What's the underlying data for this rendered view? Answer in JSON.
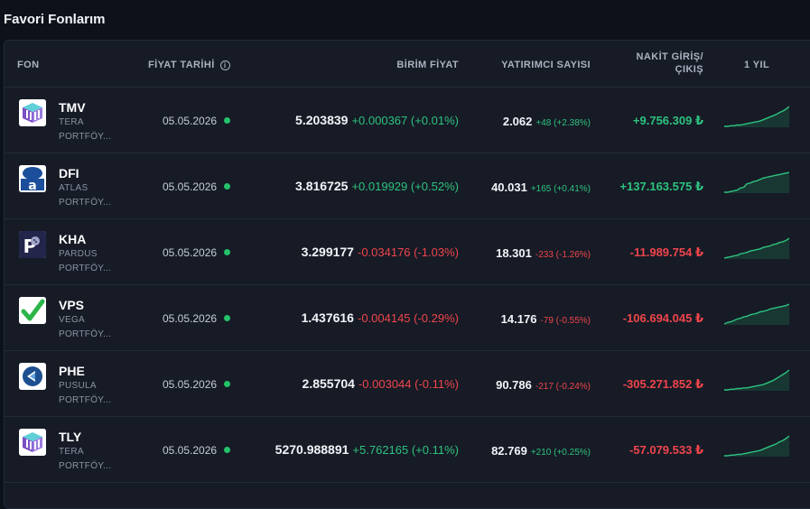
{
  "page_title": "Favori Fonlarım",
  "colors": {
    "positive": "#2ec27e",
    "negative": "#f0454b",
    "live_dot": "#24c26a"
  },
  "table": {
    "headers": {
      "fon": "FON",
      "fiyat_tarihi": "FİYAT TARİHİ",
      "birim_fiyat": "BİRİM FİYAT",
      "yatirimci_sayisi": "YATIRIMCI SAYISI",
      "nakit_giris_1": "NAKİT GİRİŞ/",
      "nakit_giris_2": "ÇIKIŞ",
      "bir_yil": "1 YIL"
    },
    "info_icon": "info-icon",
    "rows": [
      {
        "code": "TMV",
        "company": "TERA",
        "company2": "PORTFÖY...",
        "logo": "tera-logo",
        "date": "05.05.2026",
        "price": "5.203839",
        "change": "+0.000367 (+0.01%)",
        "price_trend": "up",
        "investors": "2.062",
        "investors_change": "+48 (+2.38%)",
        "investors_trend": "up",
        "cash_flow": "+9.756.309 ₺",
        "cash_trend": "up",
        "spark": [
          10,
          10,
          11,
          11,
          12,
          12,
          13,
          14,
          15,
          16,
          17,
          18,
          20,
          22,
          24,
          26,
          28,
          31,
          33,
          36,
          40
        ]
      },
      {
        "code": "DFI",
        "company": "ATLAS",
        "company2": "PORTFÖY...",
        "logo": "atlas-logo",
        "date": "05.05.2026",
        "price": "3.816725",
        "change": "+0.019929 (+0.52%)",
        "price_trend": "up",
        "investors": "40.031",
        "investors_change": "+165 (+0.41%)",
        "investors_trend": "up",
        "cash_flow": "+137.163.575 ₺",
        "cash_trend": "up",
        "spark": [
          10,
          10,
          11,
          12,
          13,
          16,
          17,
          22,
          23,
          25,
          26,
          28,
          30,
          31,
          32,
          33,
          34,
          35,
          36,
          37,
          38
        ]
      },
      {
        "code": "KHA",
        "company": "PARDUS",
        "company2": "PORTFÖY...",
        "logo": "pardus-logo",
        "date": "05.05.2026",
        "price": "3.299177",
        "change": "-0.034176 (-1.03%)",
        "price_trend": "down",
        "investors": "18.301",
        "investors_change": "-233 (-1.26%)",
        "investors_trend": "down",
        "cash_flow": "-11.989.754 ₺",
        "cash_trend": "down",
        "spark": [
          10,
          11,
          12,
          13,
          14,
          16,
          17,
          18,
          20,
          21,
          22,
          23,
          25,
          26,
          27,
          29,
          30,
          32,
          33,
          35,
          38
        ]
      },
      {
        "code": "VPS",
        "company": "VEGA",
        "company2": "PORTFÖY...",
        "logo": "vega-logo",
        "date": "05.05.2026",
        "price": "1.437616",
        "change": "-0.004145 (-0.29%)",
        "price_trend": "down",
        "investors": "14.176",
        "investors_change": "-79 (-0.55%)",
        "investors_trend": "down",
        "cash_flow": "-106.694.045 ₺",
        "cash_trend": "down",
        "spark": [
          10,
          12,
          13,
          15,
          17,
          18,
          20,
          21,
          23,
          24,
          25,
          27,
          28,
          29,
          31,
          32,
          33,
          34,
          35,
          36,
          38
        ]
      },
      {
        "code": "PHE",
        "company": "PUSULA",
        "company2": "PORTFÖY...",
        "logo": "pusula-logo",
        "date": "05.05.2026",
        "price": "2.855704",
        "change": "-0.003044 (-0.11%)",
        "price_trend": "down",
        "investors": "90.786",
        "investors_change": "-217 (-0.24%)",
        "investors_trend": "down",
        "cash_flow": "-305.271.852 ₺",
        "cash_trend": "down",
        "spark": [
          10,
          10,
          11,
          11,
          12,
          12,
          13,
          13,
          14,
          15,
          16,
          17,
          18,
          20,
          22,
          24,
          27,
          30,
          33,
          36,
          40
        ]
      },
      {
        "code": "TLY",
        "company": "TERA",
        "company2": "PORTFÖY...",
        "logo": "tera-logo",
        "date": "05.05.2026",
        "price": "5270.988891",
        "change": "+5.762165 (+0.11%)",
        "price_trend": "up",
        "investors": "82.769",
        "investors_change": "+210 (+0.25%)",
        "investors_trend": "up",
        "cash_flow": "-57.079.533 ₺",
        "cash_trend": "down",
        "spark": [
          10,
          10,
          11,
          11,
          12,
          12,
          13,
          14,
          15,
          16,
          17,
          18,
          20,
          22,
          24,
          26,
          28,
          31,
          33,
          36,
          40
        ]
      }
    ]
  }
}
